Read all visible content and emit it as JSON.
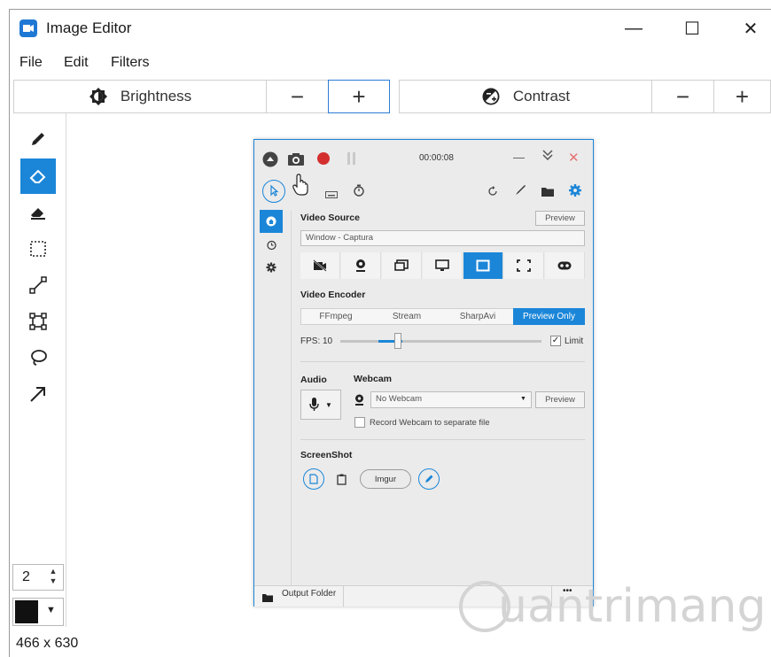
{
  "window": {
    "title": "Image Editor",
    "minimize": "—",
    "maximize": "☐",
    "close": "✕"
  },
  "menu": {
    "file": "File",
    "edit": "Edit",
    "filters": "Filters"
  },
  "toolbar": {
    "brightness_label": "Brightness",
    "minus": "−",
    "plus": "+",
    "contrast_label": "Contrast"
  },
  "tools": [
    "pencil-icon",
    "eraser-icon",
    "fill-eraser-icon",
    "select-rect-icon",
    "line-icon",
    "crop-icon",
    "lasso-icon",
    "arrow-icon"
  ],
  "brush_size": "2",
  "color": {
    "current": "#111111",
    "accent": "#1b86d8"
  },
  "image_size": "466 x 630",
  "capture_window": {
    "timer": "00:00:08",
    "video_source_title": "Video Source",
    "preview_btn": "Preview",
    "source_value": "Window - Captura",
    "video_encoder_title": "Video Encoder",
    "encoders": [
      "FFmpeg",
      "Stream",
      "SharpAvi",
      "Preview Only"
    ],
    "fps_label": "FPS:",
    "fps_value": "10",
    "fps_level": 0.27,
    "limit_label": "Limit",
    "audio_title": "Audio",
    "webcam_title": "Webcam",
    "webcam_value": "No Webcam",
    "webcam_preview": "Preview",
    "record_webcam_label": "Record Webcam to separate file",
    "screenshot_title": "ScreenShot",
    "imgur_btn": "Imgur",
    "output_folder": "Output Folder",
    "more": "•••"
  },
  "watermark": "uantrimang"
}
